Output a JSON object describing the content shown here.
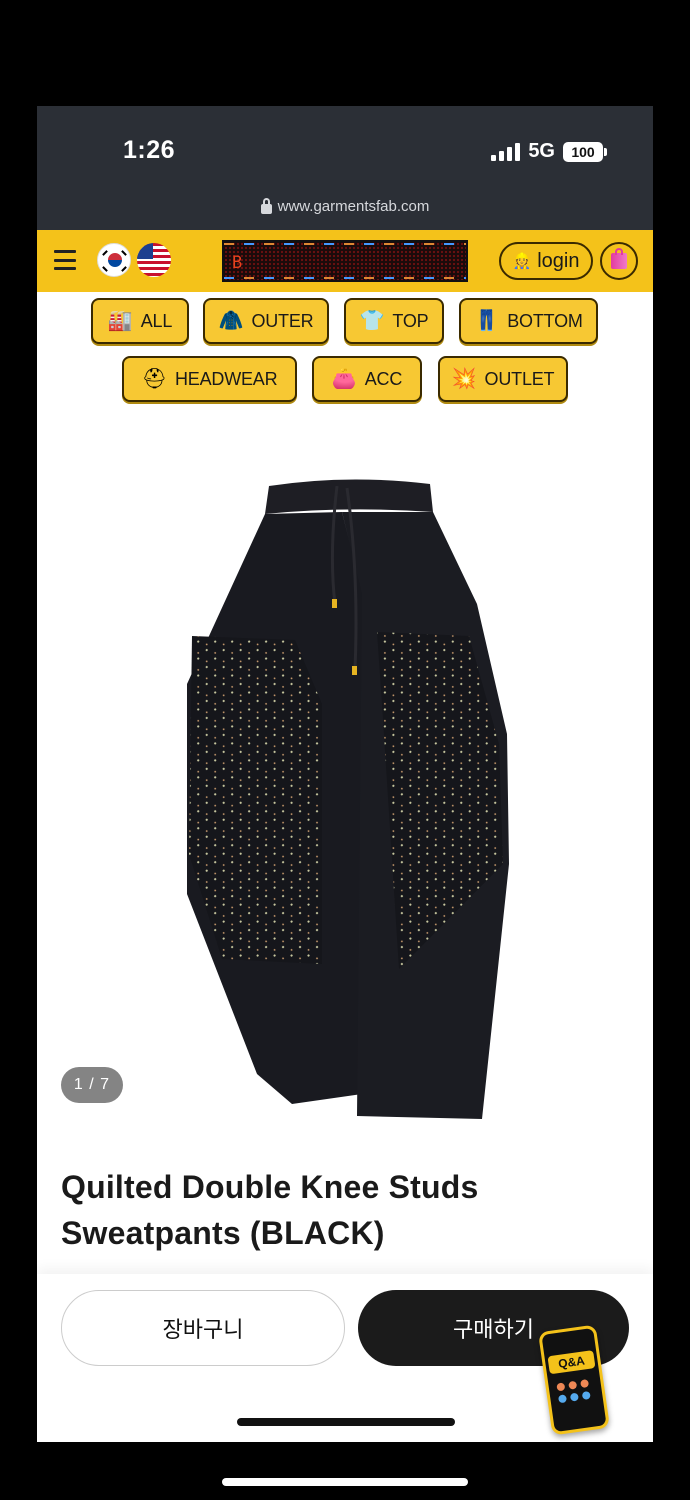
{
  "status_bar": {
    "time": "1:26",
    "network": "5G",
    "battery": "100"
  },
  "browser": {
    "url": "www.garmentsfab.com"
  },
  "header": {
    "ticker_text": "B",
    "login_label": "login"
  },
  "categories": [
    {
      "label": "ALL",
      "icon": "factory-icon"
    },
    {
      "label": "OUTER",
      "icon": "coat-icon"
    },
    {
      "label": "TOP",
      "icon": "shirt-icon"
    },
    {
      "label": "BOTTOM",
      "icon": "jeans-icon"
    },
    {
      "label": "HEADWEAR",
      "icon": "helmet-icon"
    },
    {
      "label": "ACC",
      "icon": "purse-icon"
    },
    {
      "label": "OUTLET",
      "icon": "explosion-icon"
    }
  ],
  "product": {
    "image_counter": "1 / 7",
    "title_line1": "Quilted Double Knee Studs",
    "title_line2": "Sweatpants (BLACK)"
  },
  "actions": {
    "cart_label": "장바구니",
    "buy_label": "구매하기",
    "qa_label": "Q&A"
  },
  "colors": {
    "brand_yellow": "#f4c21a",
    "dark": "#1b1b1b"
  }
}
